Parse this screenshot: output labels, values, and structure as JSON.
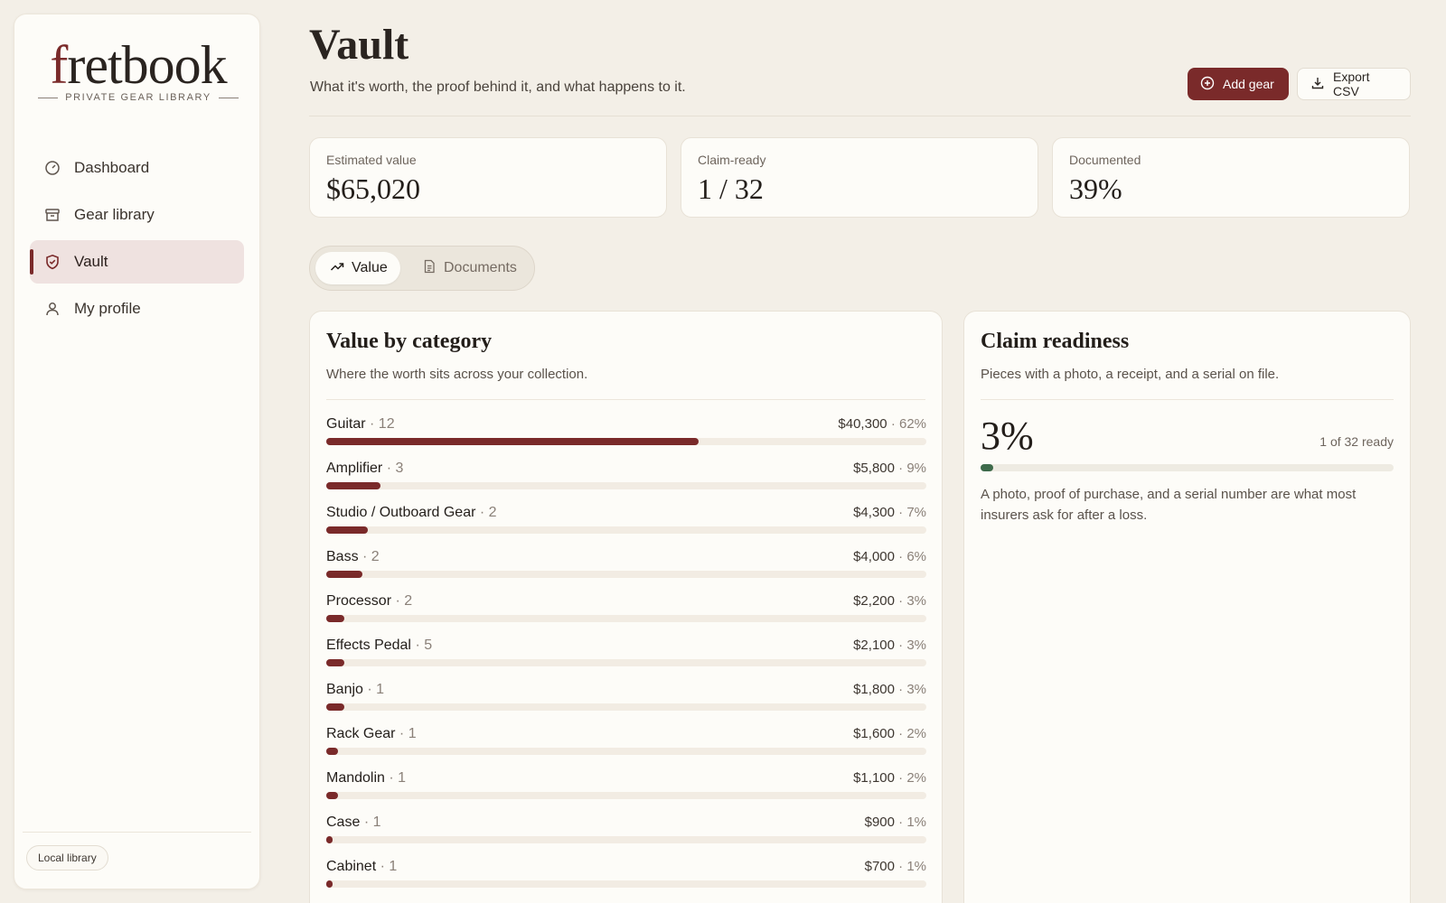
{
  "brand": {
    "logo_prefix": "f",
    "logo_rest": "retbook",
    "tagline": "PRIVATE GEAR LIBRARY"
  },
  "sidebar": {
    "items": [
      {
        "label": "Dashboard",
        "icon": "gauge-icon"
      },
      {
        "label": "Gear library",
        "icon": "archive-box-icon"
      },
      {
        "label": "Vault",
        "icon": "shield-check-icon",
        "active": true
      },
      {
        "label": "My profile",
        "icon": "user-icon"
      }
    ],
    "footer_badge": "Local library"
  },
  "header": {
    "title": "Vault",
    "subtitle": "What it's worth, the proof behind it, and what happens to it.",
    "add_label": "Add gear",
    "export_label": "Export CSV"
  },
  "stats": [
    {
      "label": "Estimated value",
      "value": "$65,020"
    },
    {
      "label": "Claim-ready",
      "value": "1 / 32"
    },
    {
      "label": "Documented",
      "value": "39%"
    }
  ],
  "tabs": [
    {
      "label": "Value",
      "icon": "trending-up-icon",
      "selected": true
    },
    {
      "label": "Documents",
      "icon": "document-icon",
      "selected": false
    }
  ],
  "value_panel": {
    "title": "Value by category",
    "subtitle": "Where the worth sits across your collection.",
    "categories": [
      {
        "name": "Guitar",
        "count": "· 12",
        "amount": "$40,300",
        "pct": "· 62%",
        "share": 0.62
      },
      {
        "name": "Amplifier",
        "count": "· 3",
        "amount": "$5,800",
        "pct": "· 9%",
        "share": 0.09
      },
      {
        "name": "Studio / Outboard Gear",
        "count": "· 2",
        "amount": "$4,300",
        "pct": "· 7%",
        "share": 0.07
      },
      {
        "name": "Bass",
        "count": "· 2",
        "amount": "$4,000",
        "pct": "· 6%",
        "share": 0.06
      },
      {
        "name": "Processor",
        "count": "· 2",
        "amount": "$2,200",
        "pct": "· 3%",
        "share": 0.03
      },
      {
        "name": "Effects Pedal",
        "count": "· 5",
        "amount": "$2,100",
        "pct": "· 3%",
        "share": 0.03
      },
      {
        "name": "Banjo",
        "count": "· 1",
        "amount": "$1,800",
        "pct": "· 3%",
        "share": 0.03
      },
      {
        "name": "Rack Gear",
        "count": "· 1",
        "amount": "$1,600",
        "pct": "· 2%",
        "share": 0.02
      },
      {
        "name": "Mandolin",
        "count": "· 1",
        "amount": "$1,100",
        "pct": "· 2%",
        "share": 0.02
      },
      {
        "name": "Case",
        "count": "· 1",
        "amount": "$900",
        "pct": "· 1%",
        "share": 0.01
      },
      {
        "name": "Cabinet",
        "count": "· 1",
        "amount": "$700",
        "pct": "· 1%",
        "share": 0.01
      }
    ]
  },
  "claim_panel": {
    "title": "Claim readiness",
    "subtitle": "Pieces with a photo, a receipt, and a serial on file.",
    "percent": "3%",
    "ready_text": "1 of 32 ready",
    "progress": 0.03,
    "note": "A photo, proof of purchase, and a serial number are what most insurers ask for after a loss."
  },
  "colors": {
    "accent": "#7a2a2a",
    "success": "#3d6a4a",
    "background": "#f3efe7",
    "card": "#fdfcf8"
  }
}
